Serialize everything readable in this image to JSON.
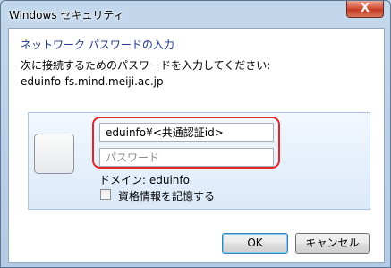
{
  "window": {
    "title": "Windows セキュリティ",
    "close_glyph": "X"
  },
  "dialog": {
    "heading": "ネットワーク パスワードの入力",
    "instruction": "次に接続するためのパスワードを入力してください:",
    "server": "eduinfo-fs.mind.meiji.ac.jp"
  },
  "credentials": {
    "username_value": "eduinfo¥<共通認証id>",
    "password_placeholder": "パスワード",
    "domain": "ドメイン: eduinfo",
    "remember_label": "資格情報を記憶する",
    "remember_checked": false
  },
  "buttons": {
    "ok": "OK",
    "cancel": "キャンセル"
  },
  "colors": {
    "heading": "#1e3a8a",
    "highlight_box": "#e02626"
  },
  "icons": [
    "user-tile-icon",
    "close-icon",
    "checkbox-icon"
  ]
}
